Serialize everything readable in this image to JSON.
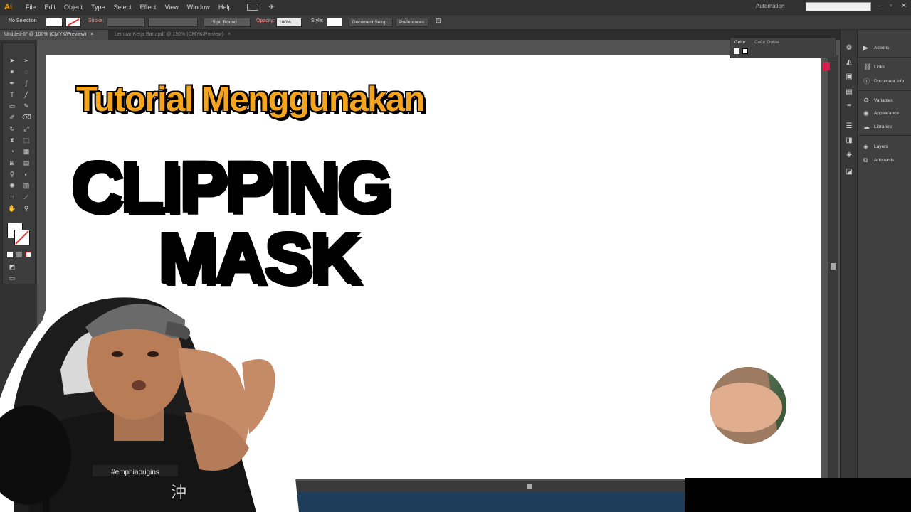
{
  "app": {
    "logo": "Ai"
  },
  "menu": [
    "File",
    "Edit",
    "Object",
    "Type",
    "Select",
    "Effect",
    "View",
    "Window",
    "Help"
  ],
  "workspace": "Automation",
  "control_bar": {
    "selection": "No Selection",
    "stroke_label": "Stroke:",
    "brush": "5 pt. Round",
    "opacity_label": "Opacity:",
    "opacity_value": "100%",
    "style_label": "Style:",
    "doc_setup": "Document Setup",
    "preferences": "Preferences"
  },
  "tabs": [
    {
      "label": "Untitled-6* @ 100% (CMYK/Preview)",
      "active": true
    },
    {
      "label": "Lembar Kerja Baru.pdf @ 150% (CMYK/Preview)",
      "active": false
    }
  ],
  "color_panel": {
    "tab1": "Color",
    "tab2": "Color Guide"
  },
  "dock_panels": [
    {
      "label": "Actions",
      "icon": "play-icon"
    },
    {
      "label": "Links",
      "icon": "link-icon"
    },
    {
      "label": "Document Info",
      "icon": "info-icon"
    },
    {
      "label": "Variables",
      "icon": "variables-icon"
    },
    {
      "label": "Appearance",
      "icon": "appearance-icon"
    },
    {
      "label": "Libraries",
      "icon": "libraries-icon"
    },
    {
      "label": "Layers",
      "icon": "layers-icon"
    },
    {
      "label": "Artboards",
      "icon": "artboards-icon"
    }
  ],
  "artwork": {
    "title": "Tutorial Menggunakan",
    "word1": "CLIPPING",
    "word2": "MASK"
  },
  "webcam": {
    "shirt_text": "#emphiaorigins",
    "shirt_glyph": "沖"
  }
}
